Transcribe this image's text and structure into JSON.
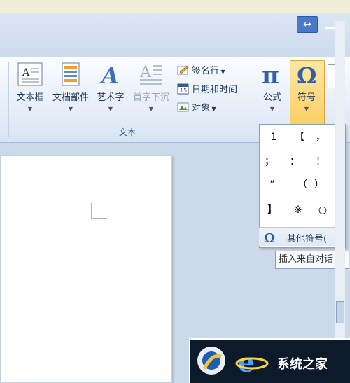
{
  "ribbon": {
    "group_text_label": "文本",
    "buttons": {
      "text_box": "文本框",
      "doc_parts": "文档部件",
      "word_art": "艺术字",
      "drop_cap": "首字下沉",
      "signature_line": "签名行",
      "date_time": "日期和时间",
      "object": "对象",
      "formula": "公式",
      "symbol": "符号"
    }
  },
  "symbol_dropdown": {
    "symbols": [
      "1",
      "【",
      "，",
      "；",
      "：",
      "！",
      "”",
      "（",
      "）",
      "】",
      "※",
      "○"
    ],
    "more_symbols_label": "其他符号(",
    "tooltip": "插入来自对话"
  },
  "watermark": {
    "text": "系统之家"
  },
  "colors": {
    "ribbon_bg": "#e7eef8",
    "symbol_highlight": "#fbcf62",
    "accent": "#4a79c9"
  }
}
